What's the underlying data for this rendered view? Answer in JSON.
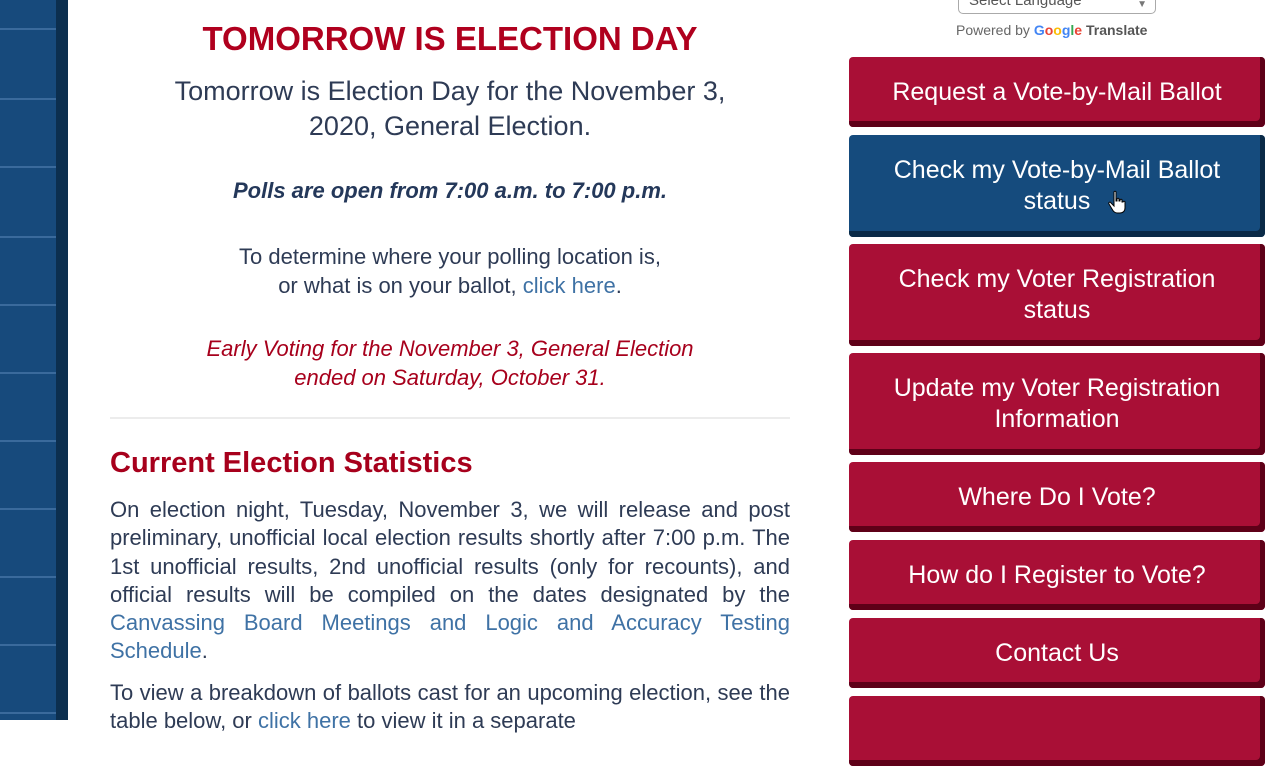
{
  "main": {
    "title": "TOMORROW IS ELECTION DAY",
    "subtitle_line1": "Tomorrow is Election Day for the November 3,",
    "subtitle_line2": "2020, General Election.",
    "polls": "Polls are open from 7:00 a.m. to 7:00 p.m.",
    "determine_line1": "To determine where your polling location is,",
    "determine_line2_prefix": "or what is on your ballot, ",
    "determine_link": "click here",
    "determine_suffix": ".",
    "early_line1": "Early Voting for the November 3, General Election",
    "early_line2": "ended on Saturday, October 31.",
    "section_heading": "Current Election Statistics",
    "stats_text": "On election night, Tuesday, November 3, we will release and post preliminary, unofficial local election results shortly after 7:00 p.m. The 1st unofficial results, 2nd unofficial results (only for recounts), and official results will be compiled on the dates designated by the ",
    "stats_link": "Canvassing Board Meetings and Logic and Accuracy Testing Schedule",
    "stats_suffix": ".",
    "breakdown_prefix": "To view a breakdown of ballots cast for an upcoming election, see the table below, or ",
    "breakdown_link": "click here",
    "breakdown_suffix": " to view it in a separate"
  },
  "translate": {
    "select_label": "Select Language",
    "powered_by": "Powered by",
    "google": [
      "G",
      "o",
      "o",
      "g",
      "l",
      "e"
    ],
    "translate_label": "Translate"
  },
  "sidebar": {
    "buttons": [
      {
        "label": "Request a Vote-by-Mail Ballot",
        "color": "red"
      },
      {
        "label": "Check my Vote-by-Mail Ballot status",
        "color": "blue"
      },
      {
        "label": "Check my Voter Registration status",
        "color": "red"
      },
      {
        "label": "Update my Voter Registration Information",
        "color": "red"
      },
      {
        "label": "Where Do I Vote?",
        "color": "red"
      },
      {
        "label": "How do I Register to Vote?",
        "color": "red"
      },
      {
        "label": "Contact Us",
        "color": "red"
      },
      {
        "label": "",
        "color": "red"
      }
    ]
  },
  "colors": {
    "accent_red": "#a90f36",
    "accent_blue": "#154b7d",
    "heading_red": "#b0001e",
    "link_blue": "#3f72a5"
  }
}
